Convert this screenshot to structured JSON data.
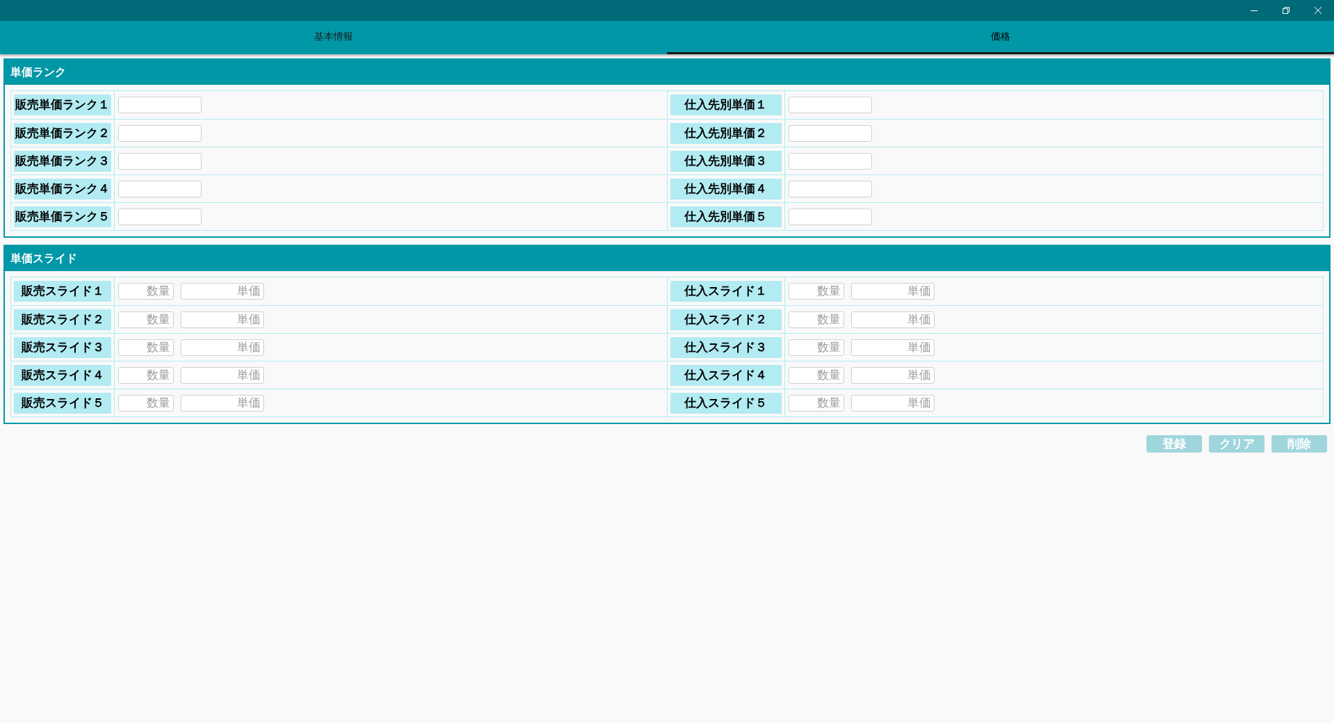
{
  "tabs": [
    {
      "label": "基本情報",
      "selected": false
    },
    {
      "label": "価格",
      "selected": true
    }
  ],
  "sections": [
    {
      "title": "単価ランク",
      "rows": [
        {
          "left": {
            "label": "販売単価ランク１",
            "fields": [
              {
                "kind": "wide"
              }
            ]
          },
          "right": {
            "label": "仕入先別単価１",
            "fields": [
              {
                "kind": "wide"
              }
            ]
          }
        },
        {
          "left": {
            "label": "販売単価ランク２",
            "fields": [
              {
                "kind": "wide"
              }
            ]
          },
          "right": {
            "label": "仕入先別単価２",
            "fields": [
              {
                "kind": "wide"
              }
            ]
          }
        },
        {
          "left": {
            "label": "販売単価ランク３",
            "fields": [
              {
                "kind": "wide"
              }
            ]
          },
          "right": {
            "label": "仕入先別単価３",
            "fields": [
              {
                "kind": "wide"
              }
            ]
          }
        },
        {
          "left": {
            "label": "販売単価ランク４",
            "fields": [
              {
                "kind": "wide"
              }
            ]
          },
          "right": {
            "label": "仕入先別単価４",
            "fields": [
              {
                "kind": "wide"
              }
            ]
          }
        },
        {
          "left": {
            "label": "販売単価ランク５",
            "fields": [
              {
                "kind": "wide"
              }
            ]
          },
          "right": {
            "label": "仕入先別単価５",
            "fields": [
              {
                "kind": "wide"
              }
            ]
          }
        }
      ]
    },
    {
      "title": "単価スライド",
      "rows": [
        {
          "left": {
            "label": "販売スライド１",
            "fields": [
              {
                "kind": "narrow",
                "placeholder": "数量"
              },
              {
                "kind": "wide",
                "placeholder": "単価"
              }
            ]
          },
          "right": {
            "label": "仕入スライド１",
            "fields": [
              {
                "kind": "narrow",
                "placeholder": "数量"
              },
              {
                "kind": "wide",
                "placeholder": "単価"
              }
            ]
          }
        },
        {
          "left": {
            "label": "販売スライド２",
            "fields": [
              {
                "kind": "narrow",
                "placeholder": "数量"
              },
              {
                "kind": "wide",
                "placeholder": "単価"
              }
            ]
          },
          "right": {
            "label": "仕入スライド２",
            "fields": [
              {
                "kind": "narrow",
                "placeholder": "数量"
              },
              {
                "kind": "wide",
                "placeholder": "単価"
              }
            ]
          }
        },
        {
          "left": {
            "label": "販売スライド３",
            "fields": [
              {
                "kind": "narrow",
                "placeholder": "数量"
              },
              {
                "kind": "wide",
                "placeholder": "単価"
              }
            ]
          },
          "right": {
            "label": "仕入スライド３",
            "fields": [
              {
                "kind": "narrow",
                "placeholder": "数量"
              },
              {
                "kind": "wide",
                "placeholder": "単価"
              }
            ]
          }
        },
        {
          "left": {
            "label": "販売スライド４",
            "fields": [
              {
                "kind": "narrow",
                "placeholder": "数量"
              },
              {
                "kind": "wide",
                "placeholder": "単価"
              }
            ]
          },
          "right": {
            "label": "仕入スライド４",
            "fields": [
              {
                "kind": "narrow",
                "placeholder": "数量"
              },
              {
                "kind": "wide",
                "placeholder": "単価"
              }
            ]
          }
        },
        {
          "left": {
            "label": "販売スライド５",
            "fields": [
              {
                "kind": "narrow",
                "placeholder": "数量"
              },
              {
                "kind": "wide",
                "placeholder": "単価"
              }
            ]
          },
          "right": {
            "label": "仕入スライド５",
            "fields": [
              {
                "kind": "narrow",
                "placeholder": "数量"
              },
              {
                "kind": "wide",
                "placeholder": "単価"
              }
            ]
          }
        }
      ]
    }
  ],
  "buttons": [
    {
      "label": "登録",
      "disabled": true
    },
    {
      "label": "クリア",
      "disabled": true
    },
    {
      "label": "削除",
      "disabled": true
    }
  ]
}
